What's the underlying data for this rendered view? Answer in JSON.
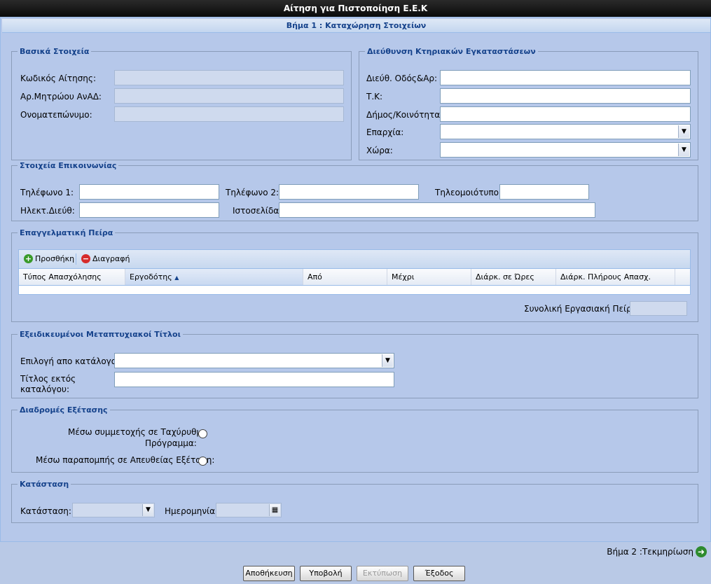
{
  "window": {
    "title": "Αίτηση για Πιστοποίηση Ε.Ε.Κ"
  },
  "step": {
    "header": "Βήμα 1 : Καταχώρηση Στοιχείων",
    "next_label": "Βήμα 2 :Τεκμηρίωση"
  },
  "basic": {
    "legend": "Βασικά Στοιχεία",
    "code_label": "Κωδικός Αίτησης:",
    "registry_label": "Αρ.Μητρώου ΑνΑΔ:",
    "name_label": "Ονοματεπώνυμο:"
  },
  "address": {
    "legend": "Διεύθυνση Κτηριακών Εγκαταστάσεων",
    "street_label": "Διεύθ. Οδός&Αρ:",
    "zip_label": "Τ.Κ:",
    "municipality_label": "Δήμος/Κοινότητα:",
    "prefecture_label": "Επαρχία:",
    "country_label": "Χώρα:"
  },
  "contact": {
    "legend": "Στοιχεία Επικοινωνίας",
    "phone1_label": "Τηλέφωνο 1:",
    "phone2_label": "Τηλέφωνο 2:",
    "fax_label": "Τηλεομοιότυπο:",
    "email_label": "Ηλεκτ.Διεύθ:",
    "website_label": "Ιστοσελίδα:"
  },
  "experience": {
    "legend": "Επαγγελματική Πείρα",
    "add_label": "Προσθήκη",
    "delete_label": "Διαγραφή",
    "columns": [
      "Τύπος Απασχόλησης",
      "Εργοδότης",
      "Από",
      "Μέχρι",
      "Διάρκ. σε Ώρες",
      "Διάρκ. Πλήρους Απασχ."
    ],
    "sort_indicator": "▲",
    "total_label": "Συνολική Εργασιακή Πείρα:"
  },
  "titles": {
    "legend": "Εξειδικευμένοι Μεταπτυχιακοί Τίτλοι",
    "catalog_label": "Επιλογή απο κατάλογο:",
    "other_label_1": "Τίτλος εκτός",
    "other_label_2": "καταλόγου:"
  },
  "exam": {
    "legend": "Διαδρομές Εξέτασης",
    "fast_track_1": "Μέσω συμμετοχής σε Ταχύρυθμο",
    "fast_track_2": "Πρόγραμμα:",
    "direct": "Μέσω παραπομπής σε Απευθείας Εξέταση:"
  },
  "status": {
    "legend": "Κατάσταση",
    "status_label": "Κατάσταση:",
    "date_label": "Ημερομηνία:"
  },
  "buttons": {
    "save": "Αποθήκευση",
    "submit": "Υποβολή",
    "print": "Εκτύπωση",
    "exit": "Έξοδος"
  },
  "colors": {
    "add_icon": "#3a9a2a",
    "delete_icon": "#d62b2b",
    "next_icon": "#2e8b2e"
  }
}
